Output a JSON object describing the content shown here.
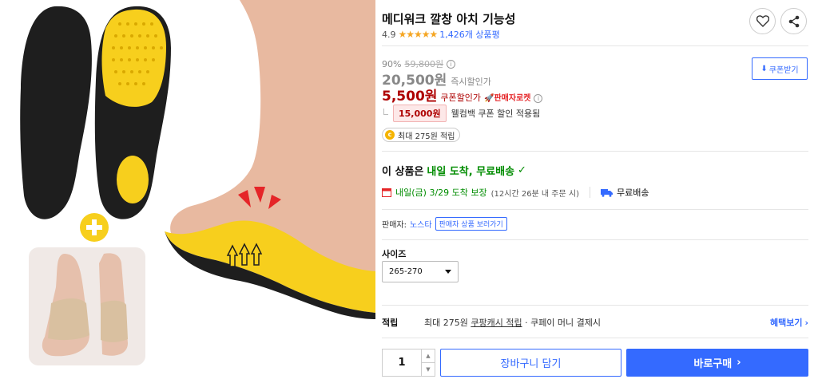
{
  "product": {
    "title": "메디워크 깔창 아치 기능성",
    "rating": "4.9",
    "stars": "★★★★★",
    "review_count": "1,426개 상품평"
  },
  "price": {
    "discount_rate": "90%",
    "original": "59,800원",
    "instant_price": "20,500원",
    "instant_label": "즉시할인가",
    "coupon_price": "5,500원",
    "coupon_label": "쿠폰할인가",
    "seller_rocket": "🚀판매자로켓",
    "coupon_button": "쿠폰받기",
    "welcome_amount": "15,000원",
    "welcome_text": "웰컴백 쿠폰 할인 적용됨",
    "reward_pill": "최대 275원 적립"
  },
  "delivery": {
    "headline_prefix": "이 상품은",
    "headline_green": "내일 도착, 무료배송",
    "check": "✓",
    "arrival": "내일(금) 3/29 도착 보장",
    "arrival_note": "(12시간 26분 내 주문 시)",
    "shipping": "무료배송"
  },
  "seller": {
    "label": "판매자:",
    "name": "노스타",
    "more": "판매자 상품 보러가기"
  },
  "option": {
    "label": "사이즈",
    "selected": "265-270"
  },
  "reward": {
    "label": "적립",
    "text_prefix": "최대 275원",
    "text_link": "쿠팡캐시 적립",
    "text_suffix": "· 쿠페이 머니 결제시",
    "benefit": "혜택보기",
    "chevron": "›"
  },
  "purchase": {
    "quantity": "1",
    "cart": "장바구니 담기",
    "buy": "바로구매",
    "buy_chevron": "›"
  },
  "colors": {
    "accent": "#346aff",
    "sale_red": "#ae0000",
    "delivery_green": "#008c00",
    "insole_yellow": "#f7cf1d",
    "insole_black": "#1e1e1e"
  }
}
